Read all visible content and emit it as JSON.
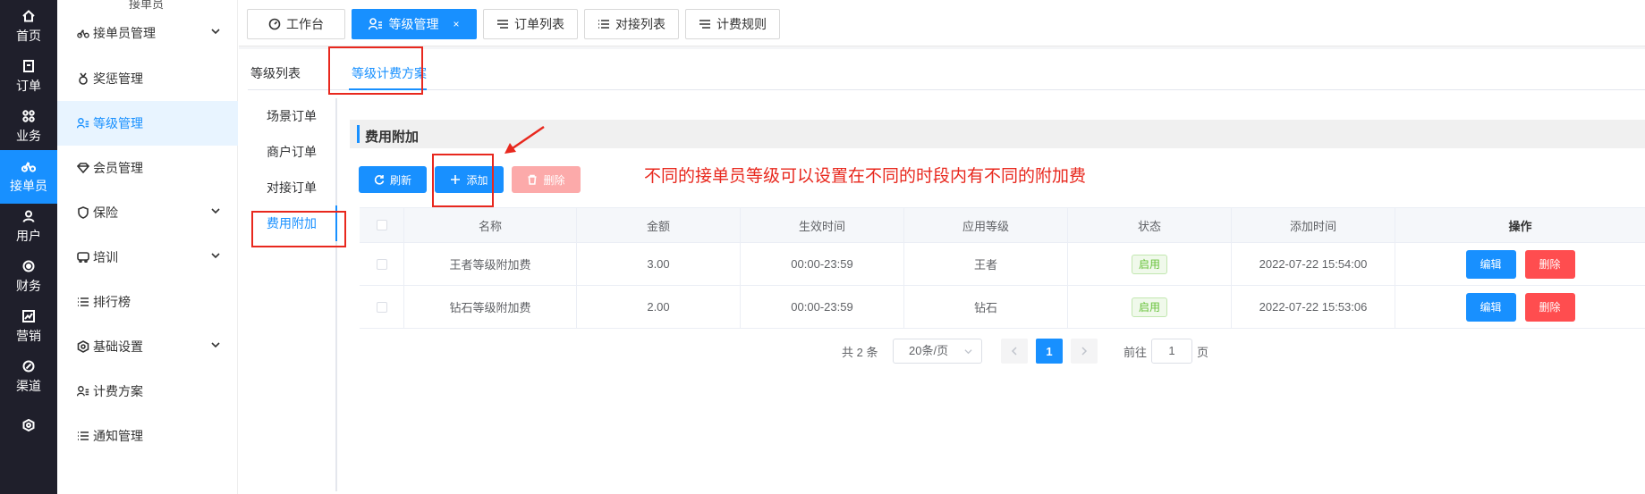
{
  "rail": [
    {
      "label": "首页",
      "icon": "home-icon"
    },
    {
      "label": "订单",
      "icon": "order-icon"
    },
    {
      "label": "业务",
      "icon": "grid-icon"
    },
    {
      "label": "接单员",
      "icon": "bike-icon",
      "active": true
    },
    {
      "label": "用户",
      "icon": "user-icon"
    },
    {
      "label": "财务",
      "icon": "finance-icon"
    },
    {
      "label": "营销",
      "icon": "chart-icon"
    },
    {
      "label": "渠道",
      "icon": "channel-icon"
    }
  ],
  "sidebar": {
    "top_label": "接单员",
    "items": [
      {
        "label": "接单员管理",
        "chevron": true
      },
      {
        "label": "奖惩管理"
      },
      {
        "label": "等级管理",
        "active": true
      },
      {
        "label": "会员管理"
      },
      {
        "label": "保险",
        "chevron": true
      },
      {
        "label": "培训",
        "chevron": true
      },
      {
        "label": "排行榜"
      },
      {
        "label": "基础设置",
        "chevron": true
      },
      {
        "label": "计费方案"
      },
      {
        "label": "通知管理"
      }
    ]
  },
  "top_tabs": [
    {
      "label": "工作台"
    },
    {
      "label": "等级管理",
      "active": true,
      "close": "×"
    },
    {
      "label": "订单列表"
    },
    {
      "label": "对接列表"
    },
    {
      "label": "计费规则"
    }
  ],
  "sub_tabs": {
    "list": "等级列表",
    "plan": "等级计费方案"
  },
  "vertical_tabs": [
    "场景订单",
    "商户订单",
    "对接订单",
    "费用附加"
  ],
  "section_title": "费用附加",
  "buttons": {
    "refresh": "刷新",
    "add": "添加",
    "delete": "删除"
  },
  "annotation": "不同的接单员等级可以设置在不同的时段内有不同的附加费",
  "table": {
    "columns": [
      "名称",
      "金额",
      "生效时间",
      "应用等级",
      "状态",
      "添加时间",
      "操作"
    ],
    "rows": [
      {
        "name": "王者等级附加费",
        "amount": "3.00",
        "time": "00:00-23:59",
        "level": "王者",
        "status": "启用",
        "added": "2022-07-22 15:54:00"
      },
      {
        "name": "钻石等级附加费",
        "amount": "2.00",
        "time": "00:00-23:59",
        "level": "钻石",
        "status": "启用",
        "added": "2022-07-22 15:53:06"
      }
    ],
    "edit_label": "编辑",
    "delete_label": "删除"
  },
  "pagination": {
    "total": "共 2 条",
    "page_size": "20条/页",
    "current": "1",
    "goto_label": "前往",
    "goto_value": "1",
    "page_suffix": "页"
  },
  "colors": {
    "primary": "#1890ff",
    "danger": "#ff4d4f",
    "annotation": "#e8281e",
    "rail_bg": "#1f1f2b"
  }
}
